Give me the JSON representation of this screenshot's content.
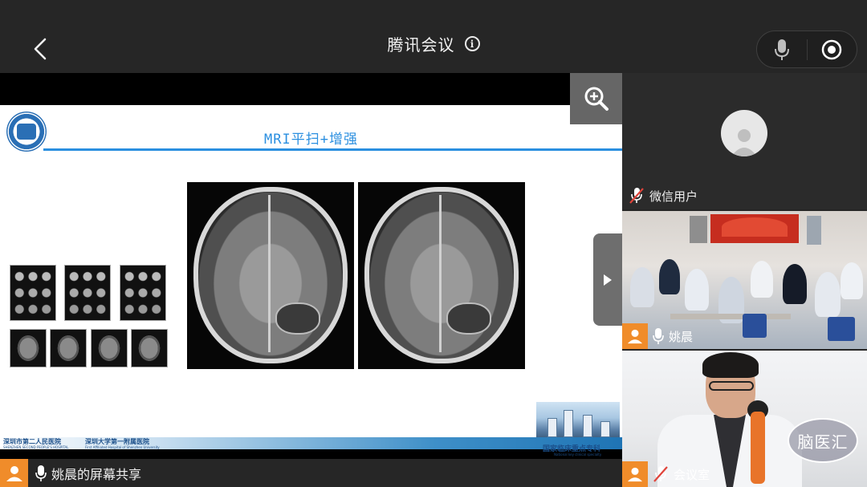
{
  "header": {
    "title": "腾讯会议",
    "back_label": "back",
    "info_icon": "i"
  },
  "controls": {
    "mic_state": "microphone",
    "record_state": "record"
  },
  "shared_screen": {
    "slide": {
      "title": "MRI平扫+增强",
      "footer_left": "深圳市第二人民医院",
      "footer_left_sub": "SHENZHEN SECOND PEOPLE'S HOSPITAL",
      "footer_mid": "深圳大学第一附属医院",
      "footer_mid_sub": "First Affiliated Hospital of Shenzhen University",
      "footer_right": "国家临床重点专科",
      "footer_right_sub": "National key clinical specialty"
    },
    "sharer_label": "姚晨的屏幕共享"
  },
  "participants": [
    {
      "name": "微信用户",
      "mic": "muted"
    },
    {
      "name": "姚晨",
      "mic": "on"
    },
    {
      "name": "会议室",
      "mic": "muted",
      "badge": "脑医汇"
    }
  ],
  "colors": {
    "accent_blue": "#2b8fe0",
    "avatar_orange": "#f08c2a",
    "bar_bg": "#262626"
  }
}
